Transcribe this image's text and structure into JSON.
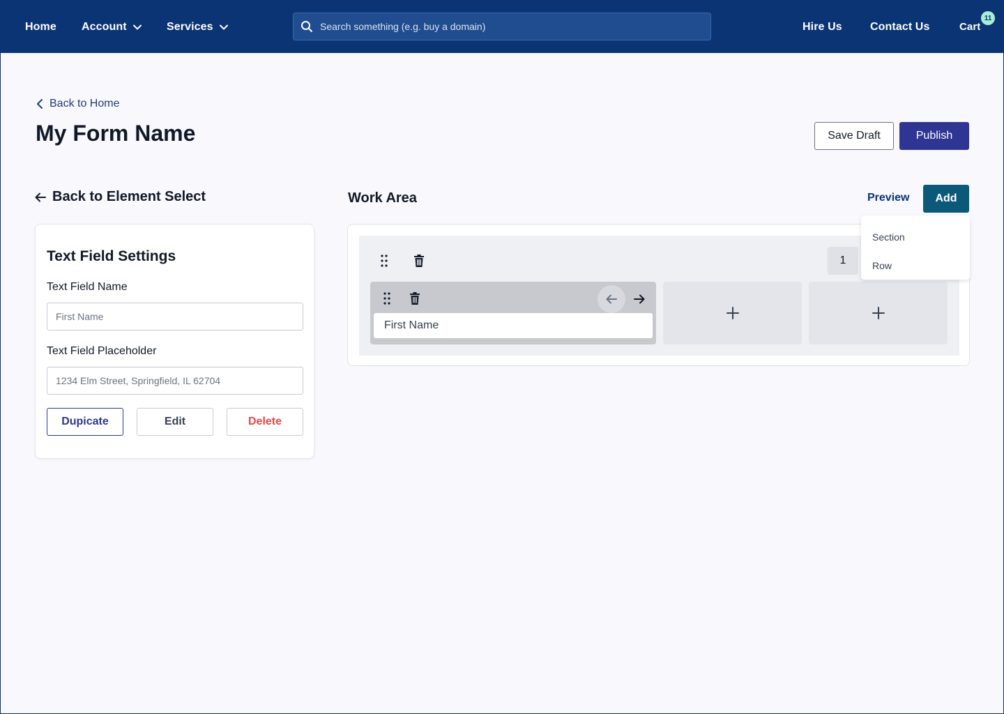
{
  "nav": {
    "home": "Home",
    "account": "Account",
    "services": "Services",
    "search_placeholder": "Search something (e.g. buy a domain)",
    "hire_us": "Hire Us",
    "contact_us": "Contact Us",
    "cart": "Cart",
    "cart_count": "11"
  },
  "header": {
    "back_home": "Back to Home",
    "title": "My Form Name",
    "save_draft": "Save Draft",
    "publish": "Publish"
  },
  "left_panel": {
    "back_element": "Back to Element Select",
    "settings_title": "Text Field Settings",
    "name_label": "Text Field Name",
    "name_placeholder": "First Name",
    "placeholder_label": "Text Field Placeholder",
    "placeholder_placeholder": "1234 Elm Street, Springfield, IL 62704",
    "duplicate": "Dupicate",
    "edit": "Edit",
    "delete": "Delete"
  },
  "work_area": {
    "title": "Work Area",
    "preview": "Preview",
    "add": "Add",
    "column_count": "1",
    "element_label": "First Name",
    "empty_add": "+"
  },
  "add_menu": {
    "items": [
      "Section",
      "Row"
    ]
  },
  "colors": {
    "nav_bg": "#0b3475",
    "primary": "#2e3592",
    "add_button": "#0c5878",
    "danger": "#ef4444",
    "badge": "#a7efd3"
  },
  "icons": [
    "search-icon",
    "chevron-down-icon",
    "chevron-left-icon",
    "arrow-left-icon",
    "arrow-right-icon",
    "drag-handle-icon",
    "trash-icon",
    "plus-icon"
  ]
}
